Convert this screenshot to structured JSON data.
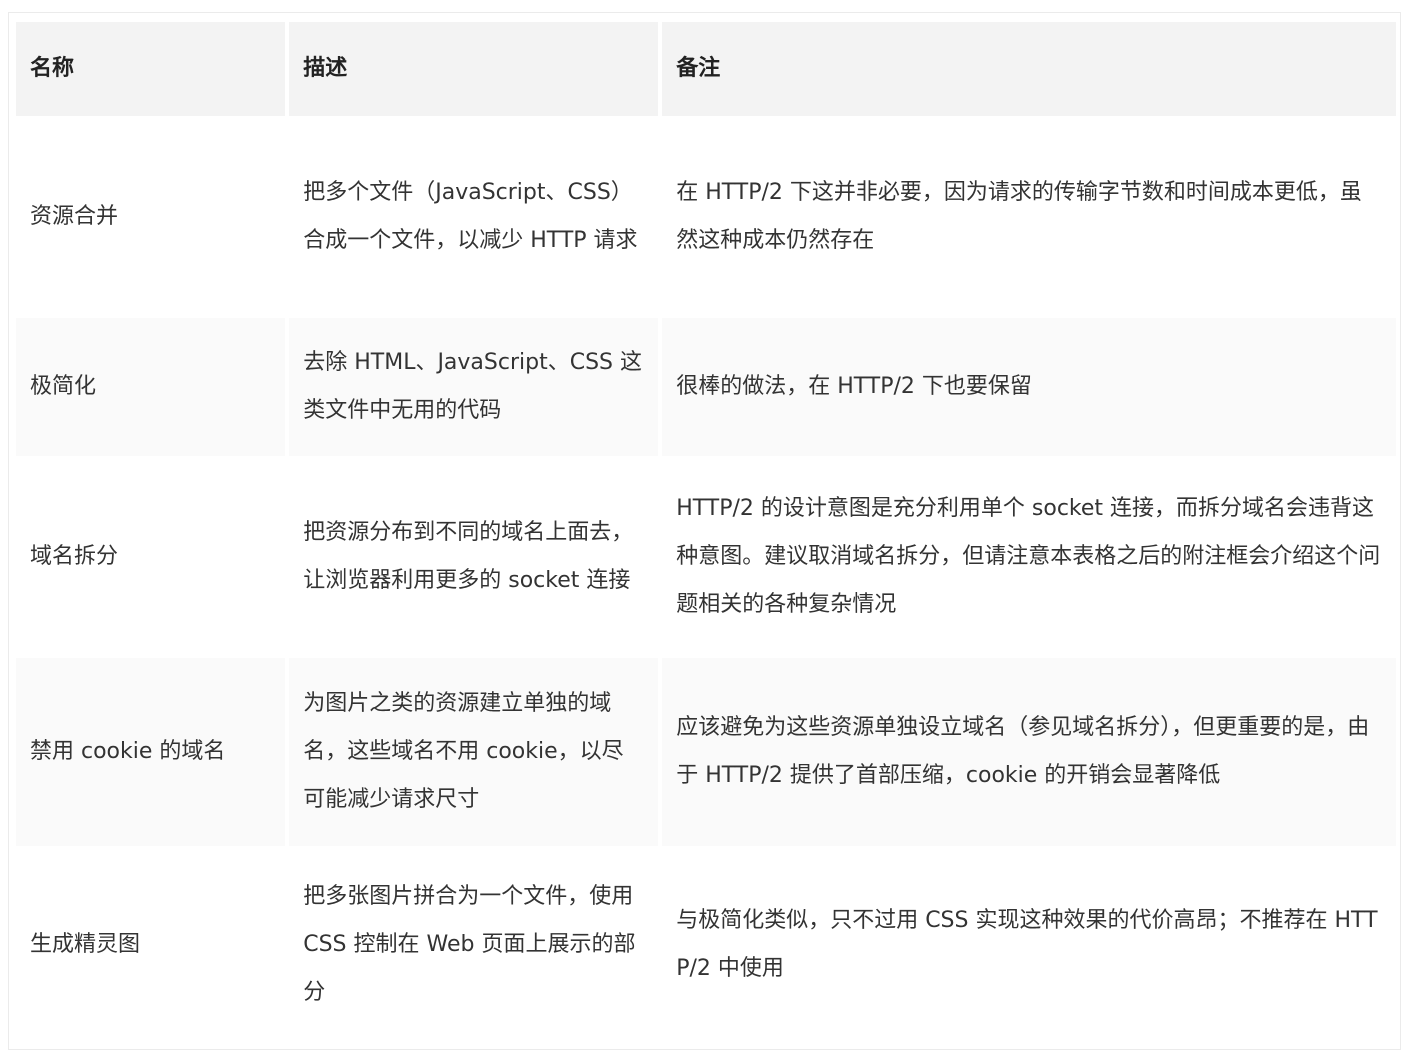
{
  "table": {
    "headers": [
      "名称",
      "描述",
      "备注"
    ],
    "rows": [
      {
        "name": "资源合并",
        "description": "把多个文件（JavaScript、CSS） 合成一个文件，以减少 HTTP 请求",
        "note": "在 HTTP/2 下这并非必要，因为请求的传输字节数和时间成本更低，虽然这种成本仍然存在"
      },
      {
        "name": "极简化",
        "description": "去除 HTML、JavaScript、CSS 这类文件中无用的代码",
        "note": "很棒的做法，在 HTTP/2 下也要保留"
      },
      {
        "name": "域名拆分",
        "description": "把资源分布到不同的域名上面去，让浏览器利用更多的 socket 连接",
        "note": "HTTP/2 的设计意图是充分利用单个 socket 连接，而拆分域名会违背这种意图。建议取消域名拆分，但请注意本表格之后的附注框会介绍这个问题相关的各种复杂情况"
      },
      {
        "name": "禁用 cookie 的域名",
        "description": "为图片之类的资源建立单独的域名，这些域名不用 cookie，以尽可能减少请求尺寸",
        "note": "应该避免为这些资源单独设立域名（参见域名拆分），但更重要的是，由于 HTTP/2 提供了首部压缩，cookie 的开销会显著降低"
      },
      {
        "name": "生成精灵图",
        "description": "把多张图片拼合为一个文件，使用 CSS 控制在 Web 页面上展示的部分",
        "note": "与极简化类似，只不过用 CSS 实现这种效果的代价高昂；不推荐在 HTTP/2 中使用"
      }
    ]
  }
}
